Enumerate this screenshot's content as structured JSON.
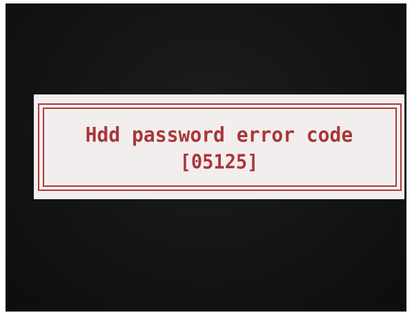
{
  "dialog": {
    "message_line1": "Hdd password error code",
    "message_line2": "[05125]"
  },
  "colors": {
    "dialog_background": "#f3eeee",
    "accent_red": "#a8373a",
    "screen_background": "#131416"
  }
}
